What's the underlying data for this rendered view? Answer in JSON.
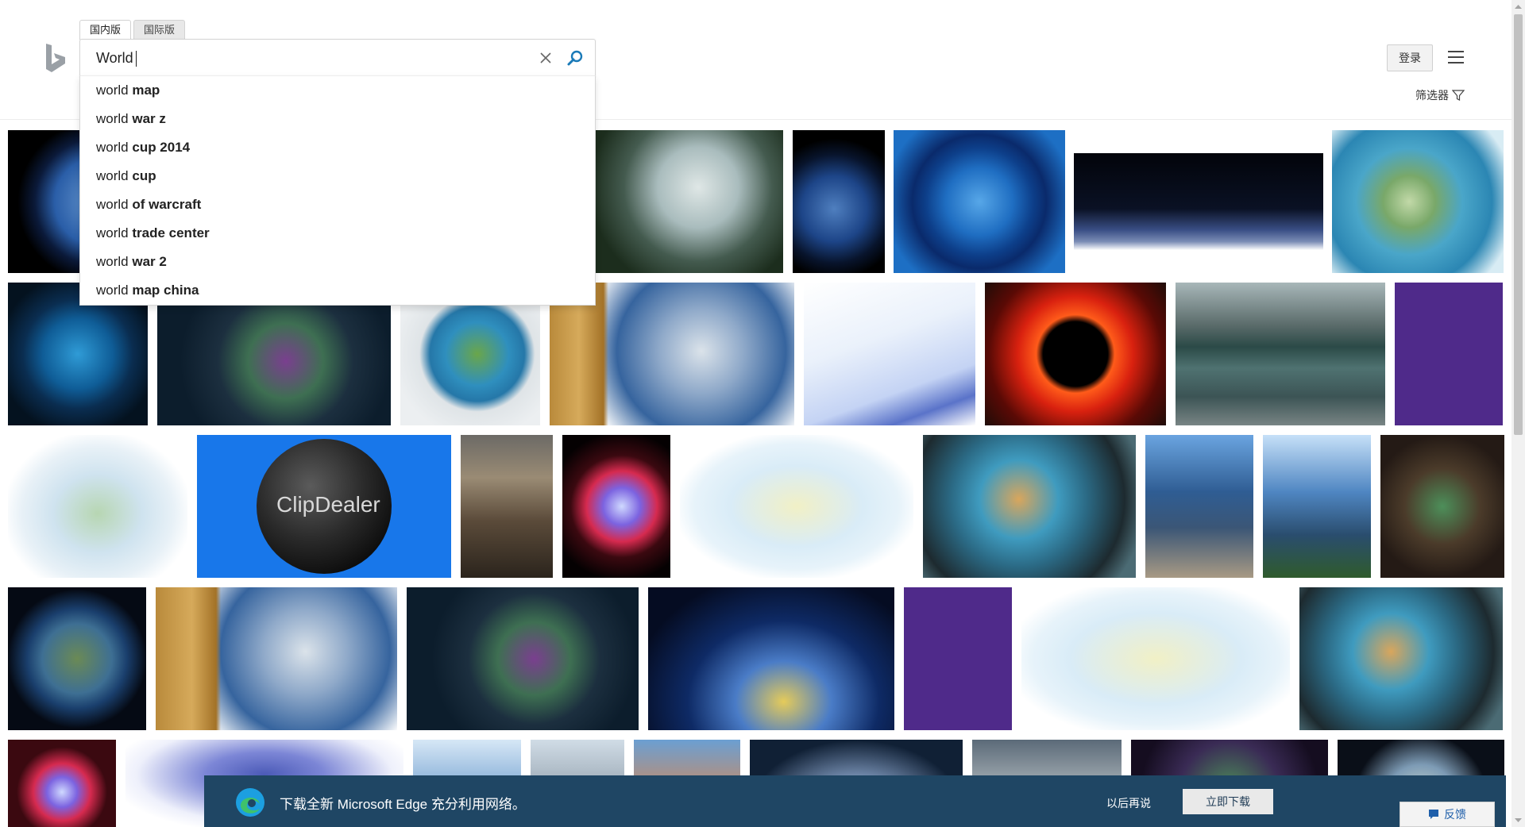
{
  "header": {
    "scope_tabs": [
      "国内版",
      "国际版"
    ],
    "login_label": "登录",
    "filter_label": "筛选器"
  },
  "search": {
    "value": "World",
    "suggestions": [
      {
        "prefix": "world",
        "suffix": "map"
      },
      {
        "prefix": "world",
        "suffix": "war z"
      },
      {
        "prefix": "world",
        "suffix": "cup 2014"
      },
      {
        "prefix": "world",
        "suffix": "cup"
      },
      {
        "prefix": "world",
        "suffix": "of warcraft"
      },
      {
        "prefix": "world",
        "suffix": "trade center"
      },
      {
        "prefix": "world",
        "suffix": "war 2"
      },
      {
        "prefix": "world",
        "suffix": "map china"
      }
    ]
  },
  "banner": {
    "text": "下载全新 Microsoft Edge 充分利用网络。",
    "later_label": "以后再说",
    "download_label": "立即下载"
  },
  "feedback_label": "反馈",
  "thumbnail_texts": {
    "clipdealer": "ClipDealer"
  },
  "colors": {
    "bing_logo": "#9aa0a6",
    "search_icon": "#1a7ab8",
    "banner_bg": "#1f4664",
    "link_blue": "#1f5faa"
  }
}
